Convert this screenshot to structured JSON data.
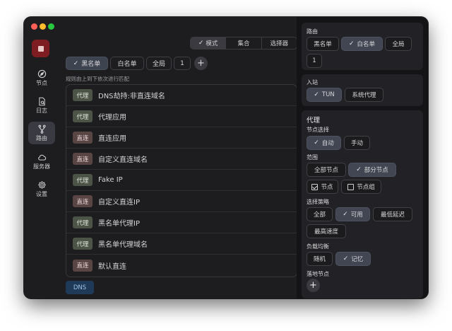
{
  "sidebar": {
    "items": [
      {
        "label": "节点",
        "icon": "compass-icon"
      },
      {
        "label": "日志",
        "icon": "log-file-icon"
      },
      {
        "label": "路由",
        "icon": "route-fork-icon"
      },
      {
        "label": "服务器",
        "icon": "cloud-icon"
      },
      {
        "label": "设置",
        "icon": "gear-icon"
      }
    ],
    "active": "路由"
  },
  "top_tabs": {
    "items": [
      "模式",
      "集合",
      "选择器"
    ],
    "selected": "模式"
  },
  "filter_chips": {
    "items": [
      "黑名单",
      "白名单",
      "全局",
      "1"
    ],
    "selected": "黑名单",
    "add": "+"
  },
  "hint": "规则由上到下依次进行匹配",
  "rules": [
    {
      "tag": "代理",
      "type": "proxy",
      "name": "DNS劫持:非直连域名"
    },
    {
      "tag": "代理",
      "type": "proxy",
      "name": "代理应用"
    },
    {
      "tag": "直连",
      "type": "direct",
      "name": "直连应用"
    },
    {
      "tag": "直连",
      "type": "direct",
      "name": "自定义直连域名"
    },
    {
      "tag": "代理",
      "type": "proxy",
      "name": "Fake IP"
    },
    {
      "tag": "直连",
      "type": "direct",
      "name": "自定义直连IP"
    },
    {
      "tag": "代理",
      "type": "proxy",
      "name": "黑名单代理IP"
    },
    {
      "tag": "代理",
      "type": "proxy",
      "name": "黑名单代理域名"
    },
    {
      "tag": "直连",
      "type": "direct",
      "name": "默认直连"
    }
  ],
  "dns_button": "DNS",
  "panel": {
    "routing": {
      "title": "路由",
      "options": [
        "黑名单",
        "白名单",
        "全局",
        "1"
      ],
      "selected": "白名单"
    },
    "inbound": {
      "title": "入站",
      "options": [
        "TUN",
        "系统代理"
      ],
      "selected": "TUN"
    },
    "proxy": {
      "title": "代理",
      "node_select": {
        "label": "节点选择",
        "options": [
          "自动",
          "手动"
        ],
        "selected": "自动"
      },
      "scope": {
        "label": "范围",
        "options": [
          "全部节点",
          "部分节点"
        ],
        "selected": "部分节点",
        "checkboxes": [
          {
            "label": "节点",
            "checked": true
          },
          {
            "label": "节点组",
            "checked": false
          }
        ]
      },
      "strategy": {
        "label": "选择策略",
        "options": [
          "全部",
          "可用",
          "最低延迟",
          "最高速度"
        ],
        "selected": "可用"
      },
      "load_balance": {
        "label": "负载均衡",
        "options": [
          "随机",
          "记忆"
        ],
        "selected": "记忆"
      },
      "landing": {
        "label": "落地节点",
        "add": "+"
      }
    }
  },
  "colors": {
    "accent": "#414652",
    "proxy_tag": "#4b5446",
    "direct_tag": "#5a4545",
    "logo": "#7d1d21",
    "dns": "#1e3a58"
  }
}
